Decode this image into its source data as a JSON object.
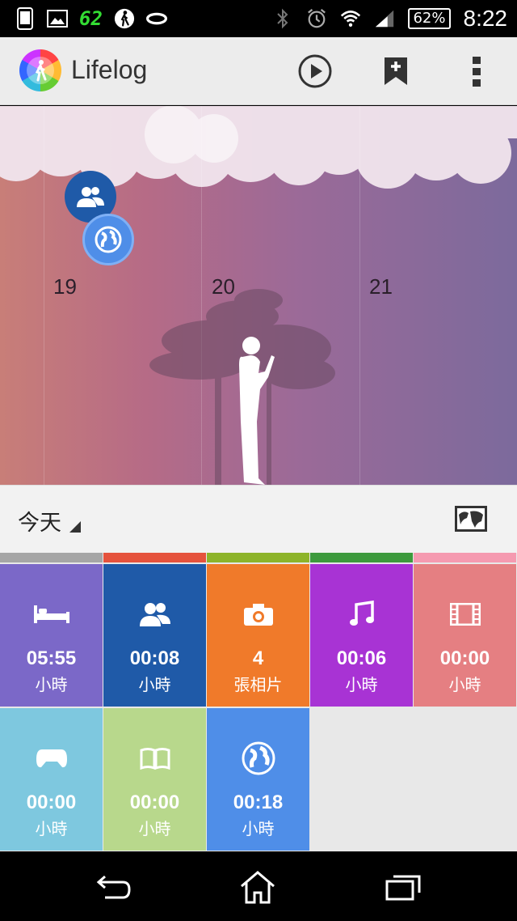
{
  "status_bar": {
    "notification_count": "62",
    "battery": "62%",
    "time": "8:22",
    "icons": [
      "phone-icon",
      "gallery-icon",
      "walk-icon",
      "band-icon",
      "bluetooth-icon",
      "alarm-icon",
      "wifi-icon",
      "signal-icon"
    ]
  },
  "app_bar": {
    "title": "Lifelog",
    "actions": [
      "play-icon",
      "bookmark-add-icon",
      "overflow-menu-icon"
    ]
  },
  "timeline": {
    "days": [
      "19",
      "20",
      "21"
    ],
    "events": [
      "people-icon",
      "globe-icon"
    ]
  },
  "date_selector": {
    "label": "今天"
  },
  "activities": [
    {
      "icon": "bed-icon",
      "value": "05:55",
      "unit": "小時",
      "color": "#7b68c8",
      "strip": "#a6a6a6"
    },
    {
      "icon": "people-icon",
      "value": "00:08",
      "unit": "小時",
      "color": "#1f5aa8",
      "strip": "#e5533d"
    },
    {
      "icon": "camera-icon",
      "value": "4",
      "unit": "張相片",
      "color": "#f07a2a",
      "strip": "#8db42a"
    },
    {
      "icon": "music-icon",
      "value": "00:06",
      "unit": "小時",
      "color": "#a833d4",
      "strip": "#3d9a3d"
    },
    {
      "icon": "film-icon",
      "value": "00:00",
      "unit": "小時",
      "color": "#e57f82",
      "strip": "#f59ab0"
    },
    {
      "icon": "gamepad-icon",
      "value": "00:00",
      "unit": "小時",
      "color": "#7ec8df",
      "strip": ""
    },
    {
      "icon": "book-icon",
      "value": "00:00",
      "unit": "小時",
      "color": "#b8d88c",
      "strip": ""
    },
    {
      "icon": "globe-icon",
      "value": "00:18",
      "unit": "小時",
      "color": "#4f8ee8",
      "strip": ""
    }
  ],
  "nav_bar": [
    "back-icon",
    "home-icon",
    "recents-icon"
  ]
}
